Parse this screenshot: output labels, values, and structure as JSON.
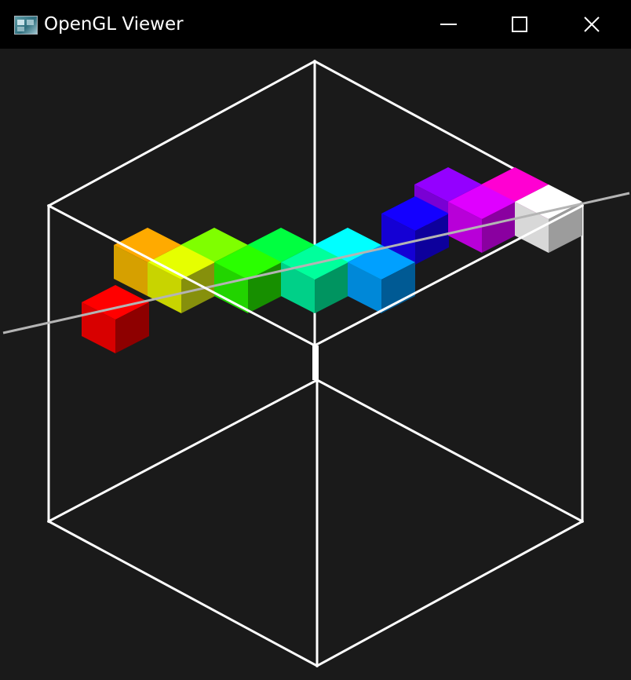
{
  "window": {
    "title": "OpenGL Viewer",
    "icon": "opengl-app-icon",
    "controls": {
      "minimize_icon": "minimize-icon",
      "maximize_icon": "maximize-icon",
      "close_icon": "close-icon"
    },
    "colors": {
      "titlebar": "#000000",
      "title_text": "#ffffff",
      "viewport_background": "#1a1a1a"
    }
  },
  "scene": {
    "bounding_box_color": "#ffffff",
    "axis_line_color": "#b4b4b4",
    "cubes": [
      {
        "name": "violet",
        "top": "#9400ff",
        "left": "#7a00d4",
        "right": "#5c00a0"
      },
      {
        "name": "hot-pink",
        "top": "#ff00d2",
        "left": "#d400ad",
        "right": "#a00085"
      },
      {
        "name": "orange",
        "top": "#ffaa00",
        "left": "#d6a000",
        "right": "#9c7400"
      },
      {
        "name": "lime",
        "top": "#7fff00",
        "left": "#6ad400",
        "right": "#4f9c00"
      },
      {
        "name": "green",
        "top": "#00ff40",
        "left": "#00d436",
        "right": "#009c28"
      },
      {
        "name": "cyan",
        "top": "#00ffff",
        "left": "#00d4d4",
        "right": "#009c9c"
      },
      {
        "name": "blue",
        "top": "#1400ff",
        "left": "#1400d4",
        "right": "#0d009c"
      },
      {
        "name": "yellow",
        "top": "#e6ff00",
        "left": "#c8d400",
        "right": "#86900c"
      },
      {
        "name": "bright-green",
        "top": "#2aff00",
        "left": "#22d400",
        "right": "#178f00"
      },
      {
        "name": "spring-green",
        "top": "#00ff9c",
        "left": "#00d088",
        "right": "#009460"
      },
      {
        "name": "azure",
        "top": "#00a0ff",
        "left": "#0088d8",
        "right": "#005a94"
      },
      {
        "name": "magenta",
        "top": "#df00ff",
        "left": "#b800d8",
        "right": "#8a00a0"
      },
      {
        "name": "white",
        "top": "#ffffff",
        "left": "#d8d8d8",
        "right": "#9c9c9c"
      },
      {
        "name": "red",
        "top": "#ff0000",
        "left": "#d80000",
        "right": "#8e0000"
      }
    ]
  }
}
